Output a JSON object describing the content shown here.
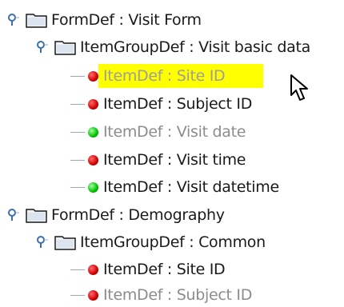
{
  "tree": [
    {
      "kind": "form",
      "label": "FormDef : Visit Form",
      "level": 0
    },
    {
      "kind": "group",
      "label": "ItemGroupDef : Visit basic data",
      "level": 1
    },
    {
      "kind": "item",
      "label": "ItemDef : Site ID",
      "status": "red",
      "selected": true,
      "dim": true
    },
    {
      "kind": "item",
      "label": "ItemDef : Subject ID",
      "status": "red"
    },
    {
      "kind": "item",
      "label": "ItemDef : Visit date",
      "status": "green",
      "dim": true
    },
    {
      "kind": "item",
      "label": "ItemDef : Visit time",
      "status": "red"
    },
    {
      "kind": "item",
      "label": "ItemDef : Visit datetime",
      "status": "green"
    },
    {
      "kind": "form",
      "label": "FormDef : Demography",
      "level": 0
    },
    {
      "kind": "group",
      "label": "ItemGroupDef : Common",
      "level": 1
    },
    {
      "kind": "item",
      "label": "ItemDef : Site ID",
      "status": "red"
    },
    {
      "kind": "item",
      "label": "ItemDef : Subject ID",
      "status": "red",
      "dim": true
    }
  ],
  "icons": {
    "handle": "expanded-node-handle-icon",
    "folder": "folder-icon",
    "red_status": "red-status-dot-icon",
    "green_status": "green-status-dot-icon",
    "pointer": "mouse-pointer-icon"
  },
  "colors": {
    "selection": "#ffff00",
    "red": "#d00000",
    "green": "#00c000",
    "handle": "#4a7ab0"
  }
}
